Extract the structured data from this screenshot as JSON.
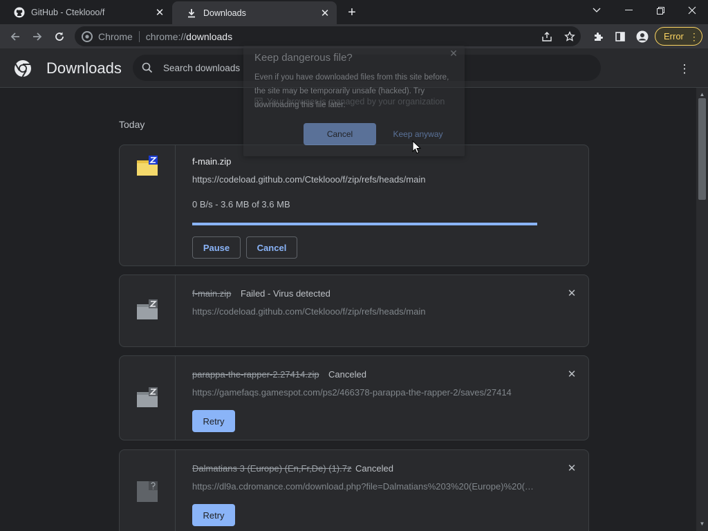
{
  "tabs": [
    {
      "title": "GitHub - Ctekl​ooo/f",
      "icon": "github-icon"
    },
    {
      "title": "Downloads",
      "icon": "download-icon"
    }
  ],
  "toolbar": {
    "security_chip": "Chrome",
    "url_scheme": "chrome://",
    "url_host": "downloads",
    "error_label": "Error"
  },
  "header": {
    "title": "Downloads",
    "search_placeholder": "Search downloads"
  },
  "section_label": "Today",
  "downloads": [
    {
      "name": "f-main.zip",
      "url": "https://codeload.github.com/Ctekl​ooo/f/zip/refs/heads/main",
      "progress_text": "0 B/s - 3.6 MB of 3.6 MB",
      "progress": 1.0,
      "pause_label": "Pause",
      "cancel_label": "Cancel"
    },
    {
      "name": "f-main.zip",
      "status": "Failed - Virus detected",
      "url": "https://codeload.github.com/Ctekl​ooo/f/zip/refs/heads/main"
    },
    {
      "name": "parappa-the-rapper-2.27414.zip",
      "status": "Canceled",
      "url": "https://gamefaqs.gamespot.com/ps2/466378-parappa-the-rapper-2/saves/27414",
      "retry_label": "Retry"
    },
    {
      "name": "Dalmatians 3 (Europe) (En,Fr,De) (1).7z",
      "status": "Canceled",
      "url": "https://dl9a.cdromance.com/download.php?file=Dalmatians%203%20(Europe)%20(E...",
      "retry_label": "Retry"
    }
  ],
  "dialog": {
    "title": "Keep dangerous file?",
    "body": "Even if you have downloaded files from this site before, the site may be temporarily unsafe (hacked). Try downloading this file later.",
    "managed_note": "Your browser is managed by your organization",
    "cancel_label": "Cancel",
    "keep_label": "Keep anyway"
  },
  "colors": {
    "accent": "#8ab4f8",
    "error": "#fdd663",
    "background": "#202124"
  }
}
